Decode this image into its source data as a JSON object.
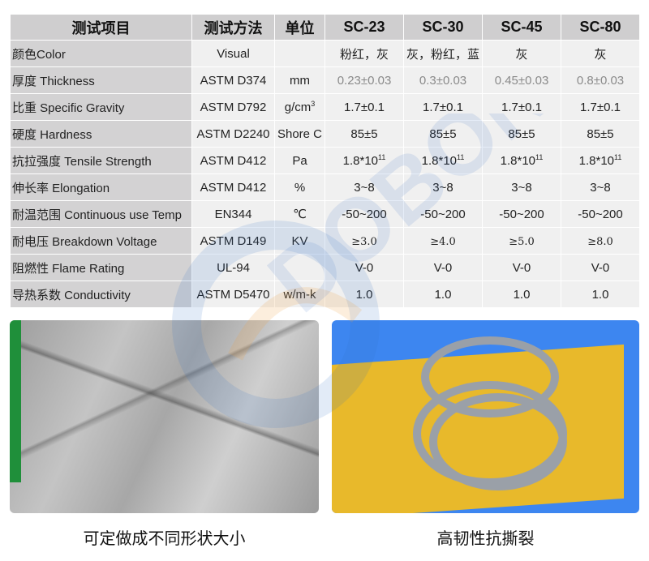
{
  "table": {
    "headers": [
      "测试项目",
      "测试方法",
      "单位",
      "SC-23",
      "SC-30",
      "SC-45",
      "SC-80"
    ],
    "rows": [
      {
        "item": "颜色Color",
        "method": "Visual",
        "unit": "",
        "values": [
          "粉红，灰",
          "灰，粉红，蓝",
          "灰",
          "灰"
        ]
      },
      {
        "item": "厚度 Thickness",
        "method": "ASTM D374",
        "unit": "mm",
        "values": [
          "0.23±0.03",
          "0.3±0.03",
          "0.45±0.03",
          "0.8±0.03"
        ]
      },
      {
        "item": "比重 Specific Gravity",
        "method": "ASTM D792",
        "unit": "g/cm",
        "unit_sup": "3",
        "values": [
          "1.7±0.1",
          "1.7±0.1",
          "1.7±0.1",
          "1.7±0.1"
        ]
      },
      {
        "item": "硬度 Hardness",
        "method": "ASTM D2240",
        "unit": "Shore C",
        "values": [
          "85±5",
          "85±5",
          "85±5",
          "85±5"
        ]
      },
      {
        "item": "抗拉强度 Tensile Strength",
        "method": "ASTM D412",
        "unit": "Pa",
        "values": [
          "1.8*10",
          "1.8*10",
          "1.8*10",
          "1.8*10"
        ],
        "values_sup": "11"
      },
      {
        "item": "伸长率 Elongation",
        "method": "ASTM D412",
        "unit": "%",
        "values": [
          "3~8",
          "3~8",
          "3~8",
          "3~8"
        ]
      },
      {
        "item": "耐温范围 Continuous use Temp",
        "method": "EN344",
        "unit": "℃",
        "values": [
          "-50~200",
          "-50~200",
          "-50~200",
          "-50~200"
        ]
      },
      {
        "item": "耐电压 Breakdown Voltage",
        "method": "ASTM D149",
        "unit": "KV",
        "values": [
          "≥3.0",
          "≥4.0",
          "≥5.0",
          "≥8.0"
        ]
      },
      {
        "item": "阻燃性 Flame Rating",
        "method": "UL-94",
        "unit": "",
        "values": [
          "V-0",
          "V-0",
          "V-0",
          "V-0"
        ]
      },
      {
        "item": "导热系数 Conductivity",
        "method": "ASTM D5470",
        "unit": "w/m-k",
        "values": [
          "1.0",
          "1.0",
          "1.0",
          "1.0"
        ]
      }
    ]
  },
  "photos": {
    "left_caption": "可定做成不同形状大小",
    "right_caption": "高韧性抗撕裂"
  },
  "watermark": {
    "text": "DOBON",
    "colors": {
      "blue": "#2f6fc4",
      "orange": "#f0a040"
    }
  }
}
